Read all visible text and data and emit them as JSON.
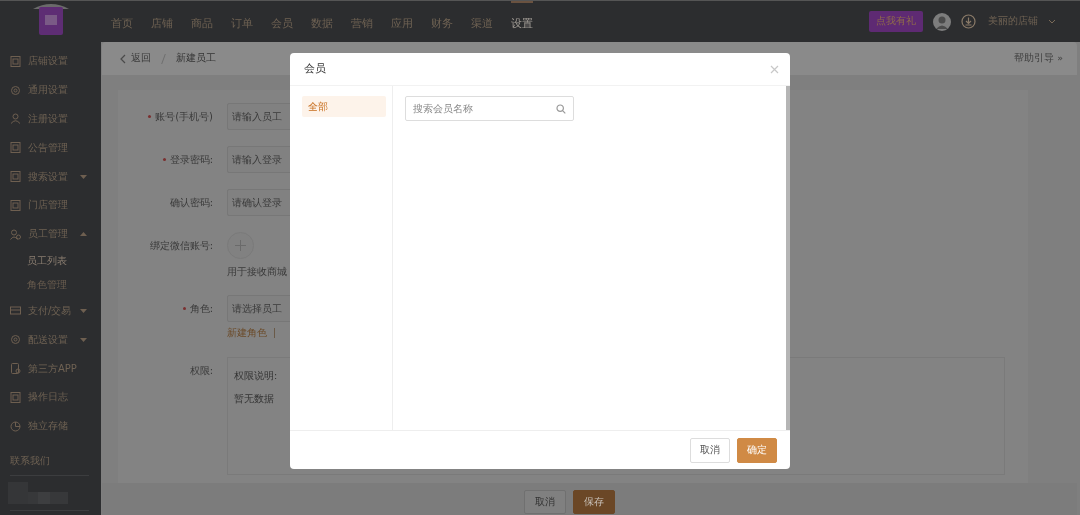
{
  "top_nav": {
    "items": [
      {
        "label": "首页",
        "selected": false
      },
      {
        "label": "店铺",
        "selected": false
      },
      {
        "label": "商品",
        "selected": false
      },
      {
        "label": "订单",
        "selected": false
      },
      {
        "label": "会员",
        "selected": false
      },
      {
        "label": "数据",
        "selected": false
      },
      {
        "label": "营销",
        "selected": false
      },
      {
        "label": "应用",
        "selected": false
      },
      {
        "label": "财务",
        "selected": false
      },
      {
        "label": "渠道",
        "selected": false
      },
      {
        "label": "设置",
        "selected": true
      }
    ],
    "promo_button": "点我有礼",
    "store_name": "美丽的店铺"
  },
  "sidebar": {
    "items": [
      {
        "label": "店铺设置"
      },
      {
        "label": "通用设置"
      },
      {
        "label": "注册设置"
      },
      {
        "label": "公告管理"
      },
      {
        "label": "搜索设置",
        "expanded": false
      },
      {
        "label": "门店管理"
      },
      {
        "label": "员工管理",
        "expanded": true,
        "children": [
          {
            "label": "员工列表",
            "selected": true
          },
          {
            "label": "角色管理",
            "selected": false
          }
        ]
      },
      {
        "label": "支付/交易",
        "expanded": false
      },
      {
        "label": "配送设置",
        "expanded": false
      },
      {
        "label": "第三方APP"
      },
      {
        "label": "操作日志"
      },
      {
        "label": "独立存储"
      }
    ],
    "contact_label": "联系我们"
  },
  "breadcrumb": {
    "back": "返回",
    "current": "新建员工",
    "help": "帮助引导 »"
  },
  "form": {
    "fields": [
      {
        "label": "账号(手机号)",
        "required": true,
        "kind": "input",
        "placeholder": "请输入员工"
      },
      {
        "label": "登录密码:",
        "required": true,
        "kind": "input",
        "placeholder": "请输入登录"
      },
      {
        "label": "确认密码:",
        "required": false,
        "kind": "input",
        "placeholder": "请确认登录"
      },
      {
        "label": "绑定微信账号:",
        "required": false,
        "kind": "upload",
        "hint": "用于接收商城"
      },
      {
        "label": "角色:",
        "required": true,
        "kind": "select",
        "placeholder": "请选择员工",
        "link": "新建角色"
      },
      {
        "label": "权限:",
        "required": false,
        "kind": "permissions",
        "title": "权限说明:",
        "empty": "暂无数据"
      }
    ],
    "buttons": [
      {
        "label": "取消",
        "kind": "secondary"
      },
      {
        "label": "保存",
        "kind": "primary"
      }
    ]
  },
  "modal": {
    "title": "会员",
    "categories": [
      {
        "label": "全部",
        "selected": true
      }
    ],
    "search": {
      "placeholder": "搜索会员名称"
    },
    "buttons": [
      {
        "label": "取消",
        "kind": "secondary"
      },
      {
        "label": "确定",
        "kind": "primary"
      }
    ]
  }
}
